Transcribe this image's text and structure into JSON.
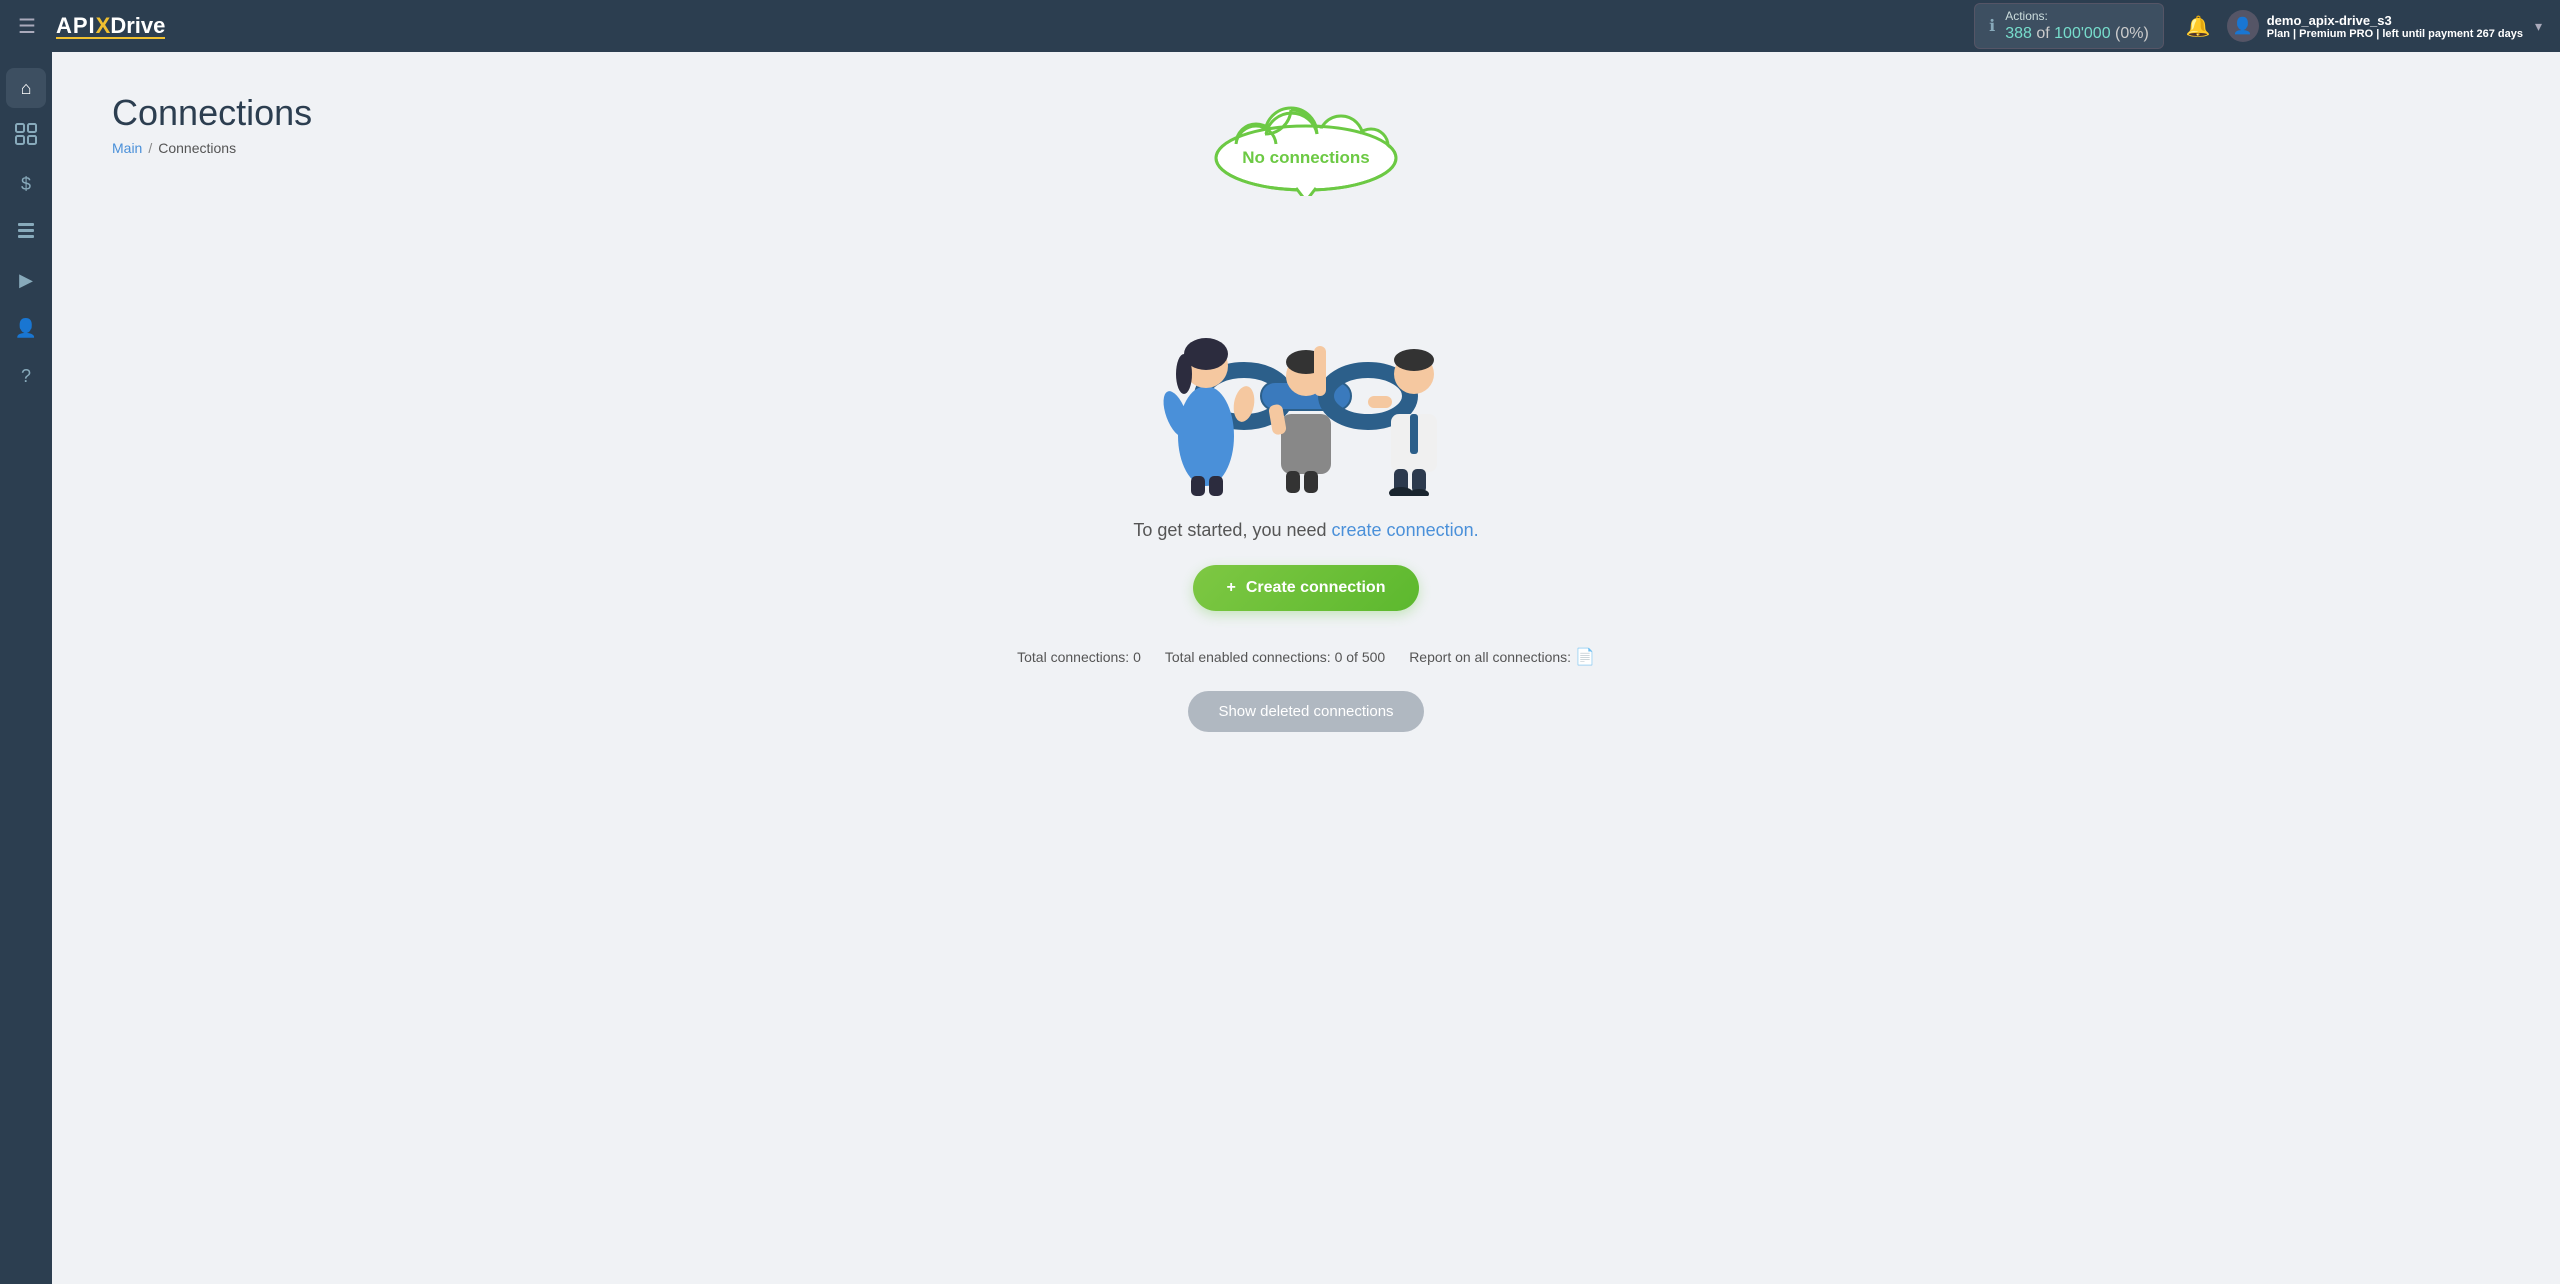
{
  "topnav": {
    "logo": {
      "api": "API",
      "x": "X",
      "drive": "Drive"
    },
    "actions": {
      "label": "Actions:",
      "count": "388",
      "separator": " of ",
      "total": "100'000",
      "pct": " (0%)"
    },
    "user": {
      "name": "demo_apix-drive_s3",
      "plan_label": "Plan |",
      "plan_name": "Premium PRO",
      "plan_sep": "| left until payment",
      "days": "267",
      "days_suffix": " days"
    },
    "chevron": "▾"
  },
  "sidebar": {
    "items": [
      {
        "icon": "⌂",
        "name": "home-icon",
        "label": "Home"
      },
      {
        "icon": "⊞",
        "name": "connections-icon",
        "label": "Connections"
      },
      {
        "icon": "$",
        "name": "billing-icon",
        "label": "Billing"
      },
      {
        "icon": "⬛",
        "name": "tools-icon",
        "label": "Tools"
      },
      {
        "icon": "▶",
        "name": "media-icon",
        "label": "Media"
      },
      {
        "icon": "👤",
        "name": "account-icon",
        "label": "Account"
      },
      {
        "icon": "?",
        "name": "help-icon",
        "label": "Help"
      }
    ]
  },
  "page": {
    "title": "Connections",
    "breadcrumb_home": "Main",
    "breadcrumb_sep": "/",
    "breadcrumb_current": "Connections"
  },
  "main": {
    "cloud_text": "No connections",
    "cta_static": "To get started, you need",
    "cta_link": "create connection.",
    "create_btn_plus": "+",
    "create_btn_label": "Create connection",
    "stats": {
      "total_connections_label": "Total connections:",
      "total_connections_value": "0",
      "total_enabled_label": "Total enabled connections:",
      "total_enabled_value": "0 of 500",
      "report_label": "Report on all connections:"
    },
    "show_deleted_label": "Show deleted connections"
  }
}
